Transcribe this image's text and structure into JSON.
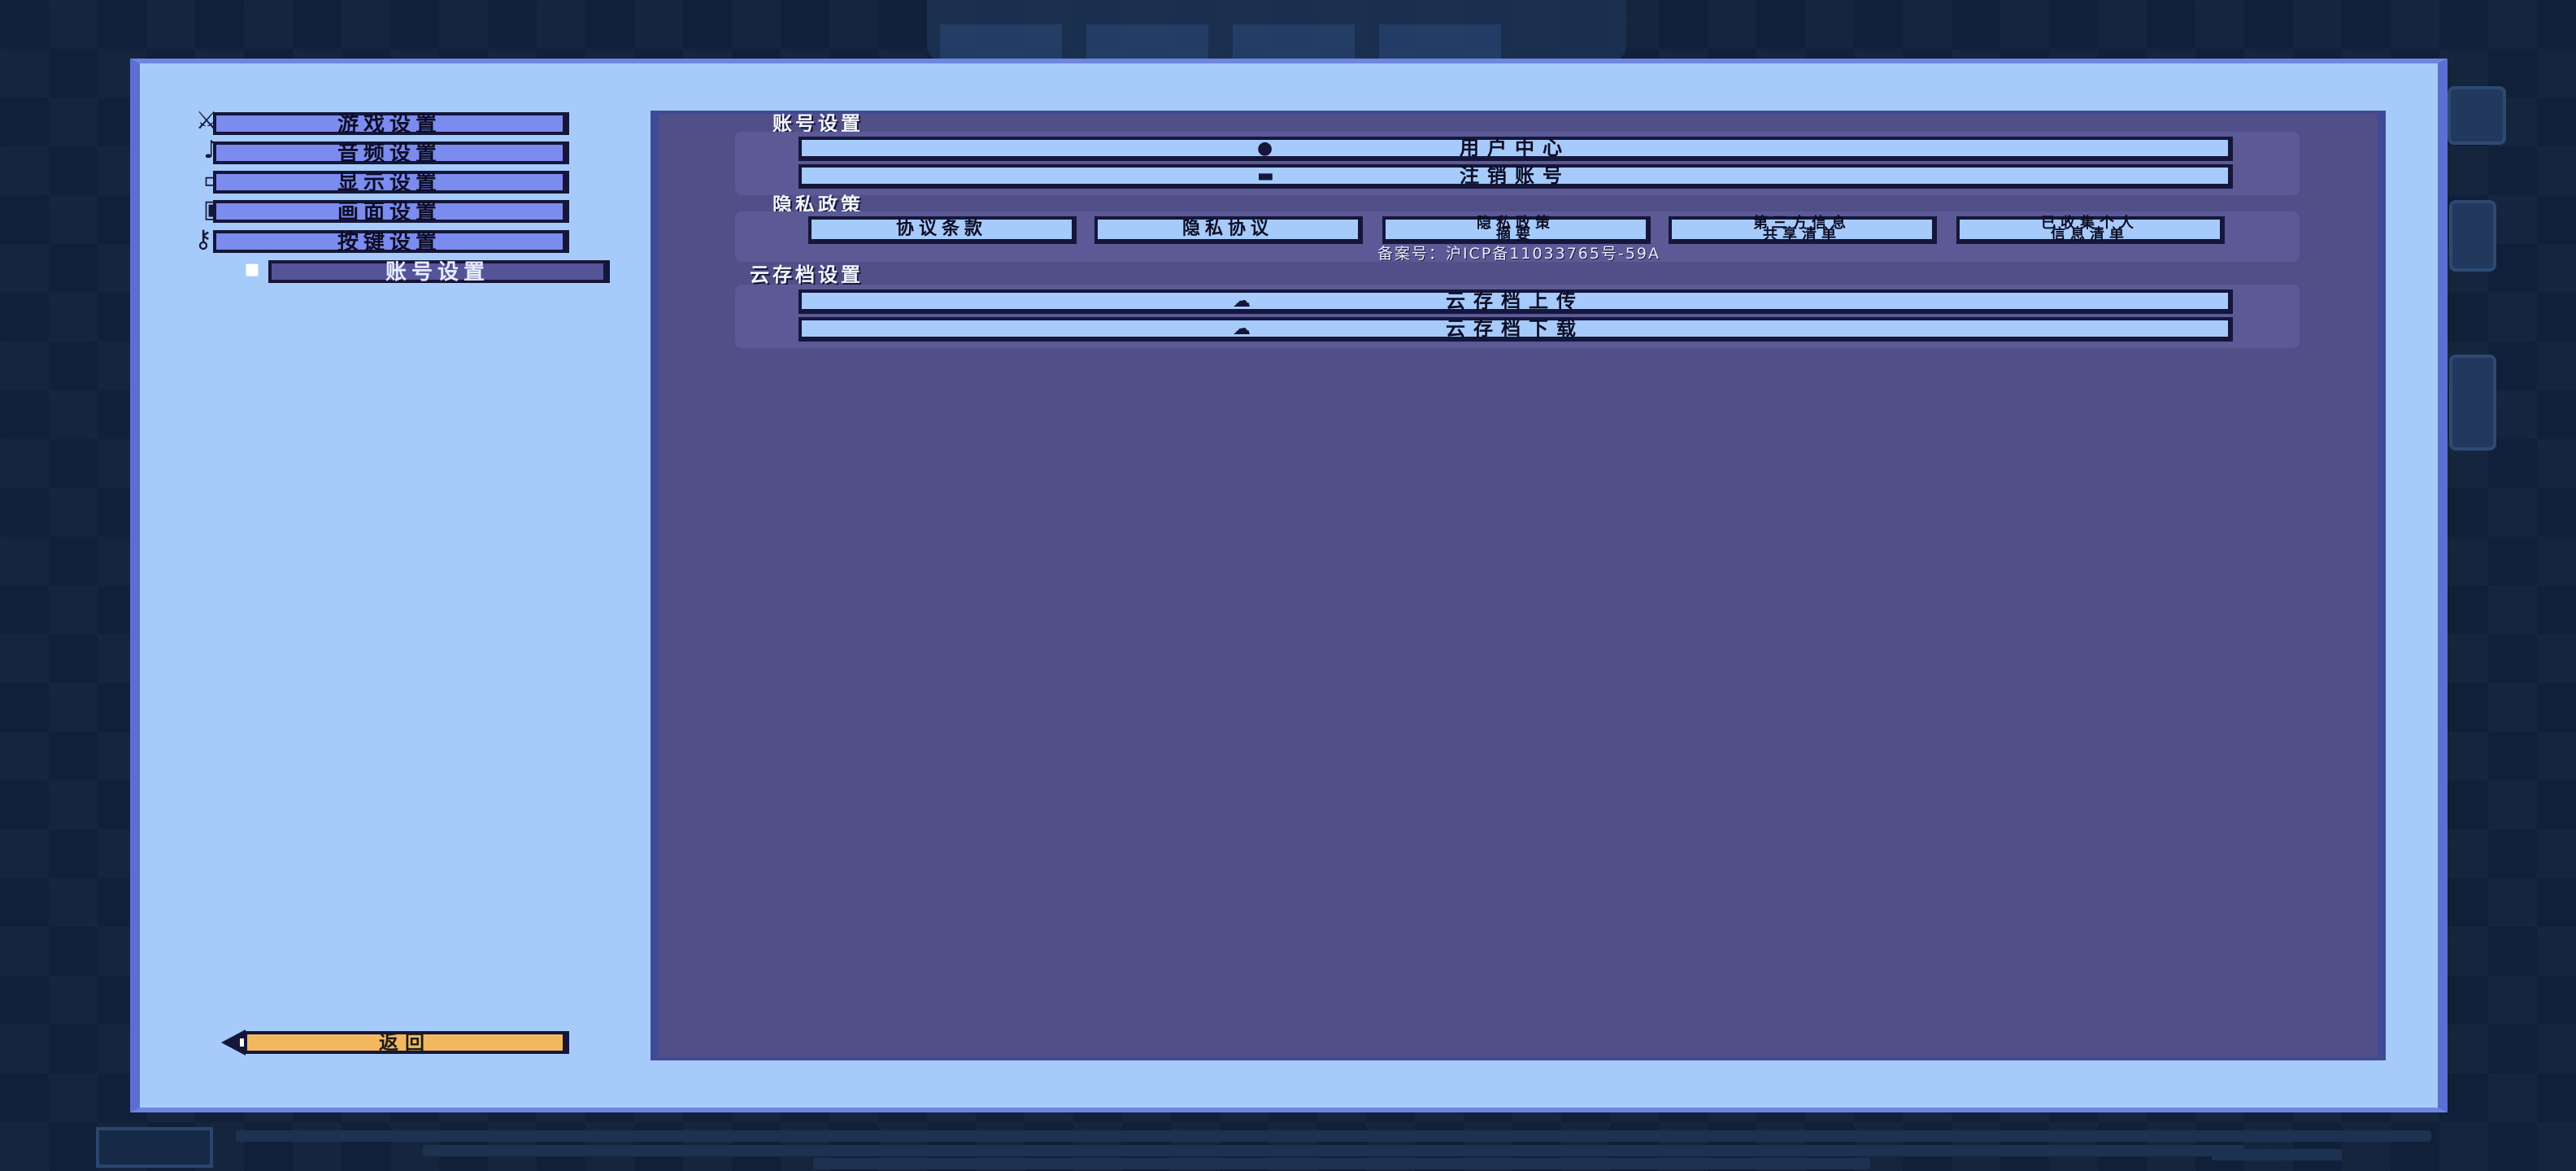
{
  "menu": {
    "items": [
      {
        "label": "游戏设置",
        "icon": "sword-icon"
      },
      {
        "label": "音频设置",
        "icon": "music-note-icon"
      },
      {
        "label": "显示设置",
        "icon": "monitor-icon"
      },
      {
        "label": "画面设置",
        "icon": "picture-icon"
      },
      {
        "label": "按键设置",
        "icon": "key-icon"
      },
      {
        "label": "账号设置",
        "icon": "user-card-icon",
        "active": true
      }
    ],
    "back_label": "返回"
  },
  "account": {
    "title": "账号设置",
    "user_center": "用户中心",
    "logout_account": "注销账号"
  },
  "privacy": {
    "title": "隐私政策",
    "buttons": [
      "协议条款",
      "隐私协议",
      "隐私政策\n摘要",
      "第三方信息\n共享清单",
      "已收集个人\n信息清单"
    ],
    "icp_number": "备案号：沪ICP备11033765号-59A"
  },
  "cloud": {
    "title": "云存档设置",
    "upload": "云存档上传",
    "download": "云存档下载"
  },
  "colors": {
    "dialog_bg": "#a6cbfb",
    "panel_bg": "#514f88",
    "menu_button": "#7b8cee",
    "menu_active": "#545497",
    "back_button": "#f2b860",
    "outline": "#15163a"
  }
}
